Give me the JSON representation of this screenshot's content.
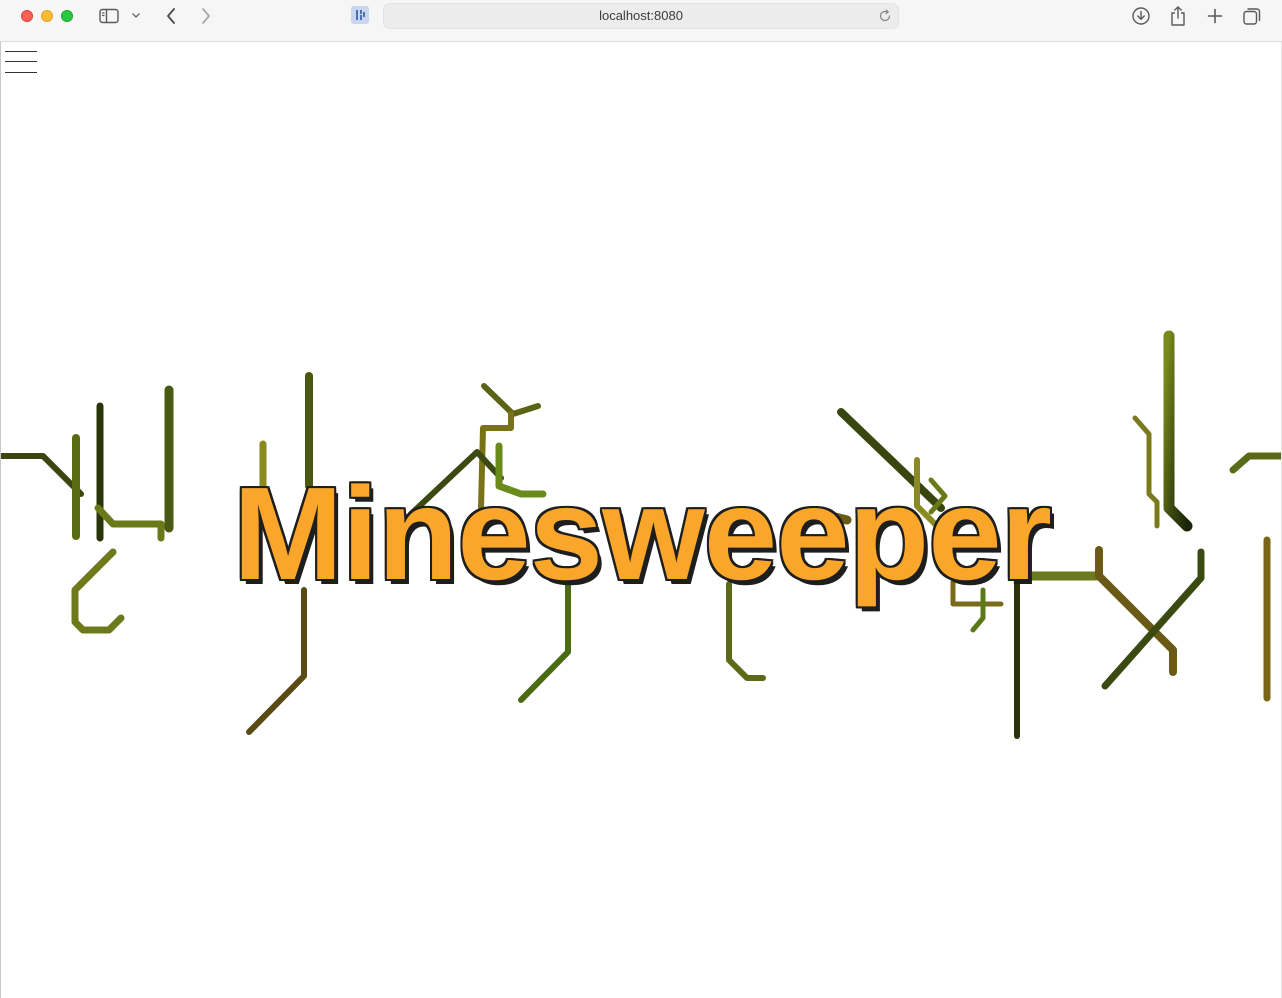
{
  "browser": {
    "url": "localhost:8080",
    "icons": {
      "close": "close-window",
      "minimize": "minimize-window",
      "maximize": "maximize-window",
      "sidebar": "sidebar-icon",
      "sidebar_chevron": "chevron-down-icon",
      "back": "back-icon",
      "forward": "forward-icon",
      "reload": "reload-icon",
      "download": "download-icon",
      "share": "share-icon",
      "new_tab": "plus-icon",
      "tabs_overview": "tabs-icon"
    }
  },
  "page": {
    "title": "Minesweeper",
    "title_color": "#f9a62a",
    "menu_icon": "hamburger-menu-icon"
  }
}
